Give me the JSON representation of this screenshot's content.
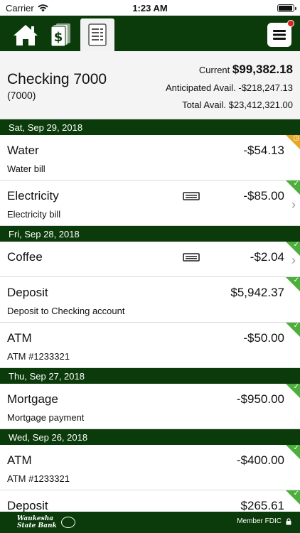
{
  "status_bar": {
    "carrier": "Carrier",
    "time": "1:23 AM"
  },
  "nav": {
    "tabs": [
      {
        "icon": "home-icon"
      },
      {
        "icon": "money-icon"
      },
      {
        "icon": "statement-icon",
        "active": true
      }
    ],
    "menu_icon": "hamburger-menu-icon",
    "notification": true
  },
  "account": {
    "name": "Checking 7000",
    "number": "(7000)",
    "current_label": "Current",
    "current_value": "$99,382.18",
    "anticipated_label": "Anticipated Avail.",
    "anticipated_value": "-$218,247.13",
    "total_label": "Total Avail.",
    "total_value": "$23,412,321.00"
  },
  "groups": [
    {
      "date": "Sat, Sep 29, 2018",
      "transactions": [
        {
          "title": "Water",
          "subtitle": "Water bill",
          "amount": "-$54.13",
          "status": "pending"
        },
        {
          "title": "Electricity",
          "subtitle": "Electricity bill",
          "amount": "-$85.00",
          "status": "cleared",
          "receipt": true,
          "chevron": true
        }
      ]
    },
    {
      "date": "Fri, Sep 28, 2018",
      "transactions": [
        {
          "title": "Coffee",
          "subtitle": "",
          "amount": "-$2.04",
          "status": "cleared",
          "receipt": true,
          "chevron": true
        },
        {
          "title": "Deposit",
          "subtitle": "Deposit to Checking account",
          "amount": "$5,942.37",
          "status": "cleared"
        },
        {
          "title": "ATM",
          "subtitle": "ATM #1233321",
          "amount": "-$50.00",
          "status": "cleared"
        }
      ]
    },
    {
      "date": "Thu, Sep 27, 2018",
      "transactions": [
        {
          "title": "Mortgage",
          "subtitle": "Mortgage payment",
          "amount": "-$950.00",
          "status": "cleared"
        }
      ]
    },
    {
      "date": "Wed, Sep 26, 2018",
      "transactions": [
        {
          "title": "ATM",
          "subtitle": "ATM #1233321",
          "amount": "-$400.00",
          "status": "cleared"
        },
        {
          "title": "Deposit",
          "subtitle": "",
          "amount": "$265.61",
          "status": "cleared"
        }
      ]
    }
  ],
  "footer": {
    "bank_name_line1": "Waukesha",
    "bank_name_line2": "State Bank",
    "fdic": "Member FDIC",
    "lock_icon": "lock-icon"
  },
  "colors": {
    "primary": "#0b3b0b",
    "cleared": "#4caf3c",
    "pending": "#e6a823"
  }
}
